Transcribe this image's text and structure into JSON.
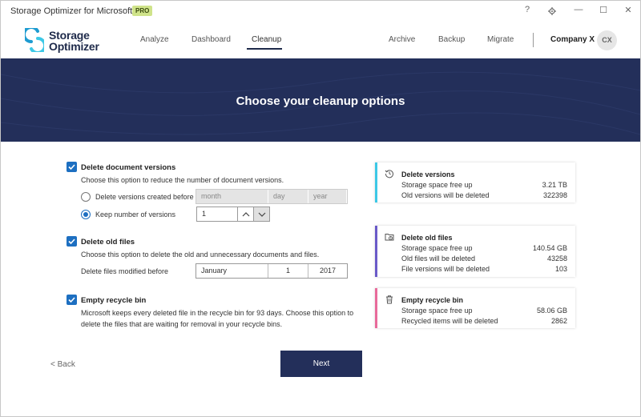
{
  "app": {
    "title": "Storage Optimizer for Microsoft 365",
    "badge": "PRO"
  },
  "window_controls": {
    "help": "?",
    "settings_icon": "gear-icon",
    "minimize": "—",
    "maximize": "☐",
    "close": "✕"
  },
  "logo": {
    "line1": "Storage",
    "line2": "Optimizer"
  },
  "nav": {
    "left": [
      "Analyze",
      "Dashboard",
      "Cleanup"
    ],
    "right": [
      "Archive",
      "Backup",
      "Migrate"
    ],
    "active": "Cleanup"
  },
  "account": {
    "company": "Company X",
    "initials": "CX"
  },
  "banner": {
    "title": "Choose your cleanup options"
  },
  "options": {
    "versions": {
      "title": "Delete document versions",
      "description": "Choose this option to reduce the number of document versions.",
      "radio_date_label": "Delete versions created before",
      "date_placeholders": {
        "month": "month",
        "day": "day",
        "year": "year"
      },
      "radio_keep_label": "Keep number of versions",
      "keep_value": "1"
    },
    "old_files": {
      "title": "Delete old files",
      "description": "Choose this option to delete the old and unnecessary documents and files.",
      "modified_label": "Delete files modified before",
      "date": {
        "month": "January",
        "day": "1",
        "year": "2017"
      }
    },
    "recycle": {
      "title": "Empty recycle bin",
      "description_line1": "Microsoft keeps every deleted file in the recycle bin for 93 days. Choose this option to",
      "description_line2": "delete the files that are waiting for removal in your recycle bins."
    }
  },
  "summary": {
    "versions": {
      "title": "Delete versions",
      "accent": "#3cc8e6",
      "rows": [
        {
          "label": "Storage space free up",
          "value": "3.21 TB"
        },
        {
          "label": "Old versions will be deleted",
          "value": "322398"
        }
      ]
    },
    "old_files": {
      "title": "Delete old files",
      "accent": "#6a5ac8",
      "rows": [
        {
          "label": "Storage space free up",
          "value": "140.54 GB"
        },
        {
          "label": "Old files will be deleted",
          "value": "43258"
        },
        {
          "label": "File versions will be deleted",
          "value": "103"
        }
      ]
    },
    "recycle": {
      "title": "Empty recycle bin",
      "accent": "#e86a9a",
      "rows": [
        {
          "label": "Storage space free up",
          "value": "58.06 GB"
        },
        {
          "label": "Recycled items will be deleted",
          "value": "2862"
        }
      ]
    }
  },
  "footer": {
    "back": "< Back",
    "next": "Next"
  },
  "colors": {
    "navy": "#232f5a",
    "check_blue": "#1d6fc1"
  }
}
